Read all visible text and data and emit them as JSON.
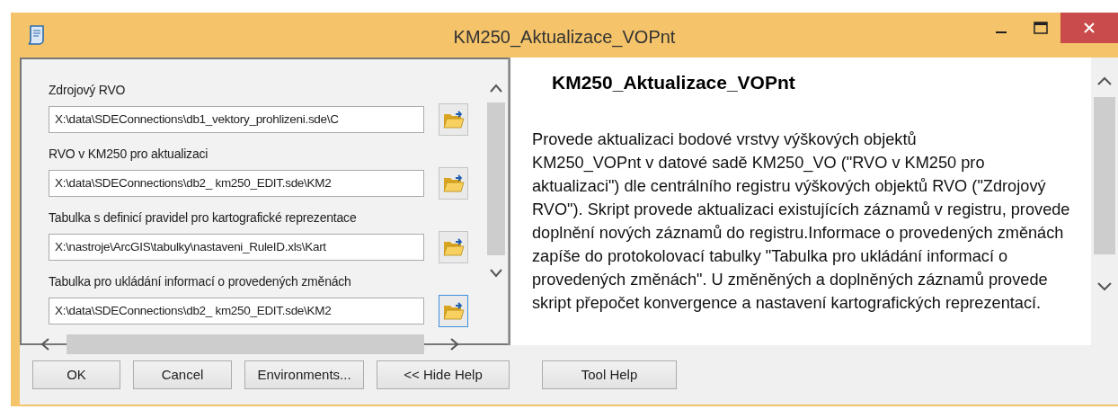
{
  "window": {
    "title": "KM250_Aktualizace_VOPnt"
  },
  "parameters": [
    {
      "label": "Zdrojový RVO",
      "value": "X:\\data\\SDEConnections\\db1_vektory_prohlizeni.sde\\C",
      "focused": false
    },
    {
      "label": "RVO v  KM250 pro aktualizaci",
      "value": "X:\\data\\SDEConnections\\db2_ km250_EDIT.sde\\KM2",
      "focused": false
    },
    {
      "label": "Tabulka s definicí pravidel pro kartografické reprezentace",
      "value": "X:\\nastroje\\ArcGIS\\tabulky\\nastaveni_RuleID.xls\\Kart",
      "focused": false
    },
    {
      "label": "Tabulka pro ukládání informací o provedených změnách",
      "value": "X:\\data\\SDEConnections\\db2_ km250_EDIT.sde\\KM2",
      "focused": true
    }
  ],
  "help": {
    "title": "KM250_Aktualizace_VOPnt",
    "text": "Provede aktualizaci bodové vrstvy výškových objektů\nKM250_VOPnt v datové sadě  KM250_VO  (\"RVO v KM250 pro\naktualizaci\") dle centrálního registru výškových objektů RVO (\"Zdrojový RVO\"). Skript provede aktualizaci existujících záznamů v registru, provede doplnění nových záznamů do registru.Informace o provedených změnách zapíše do protokolovací tabulky \"Tabulka pro ukládání informací o provedených změnách\". U změněných a doplněných záznamů provede skript přepočet konvergence a nastavení kartografických reprezentací."
  },
  "buttons": [
    "OK",
    "Cancel",
    "Environments...",
    "<< Hide Help"
  ],
  "help_buttons": [
    "Tool Help"
  ]
}
